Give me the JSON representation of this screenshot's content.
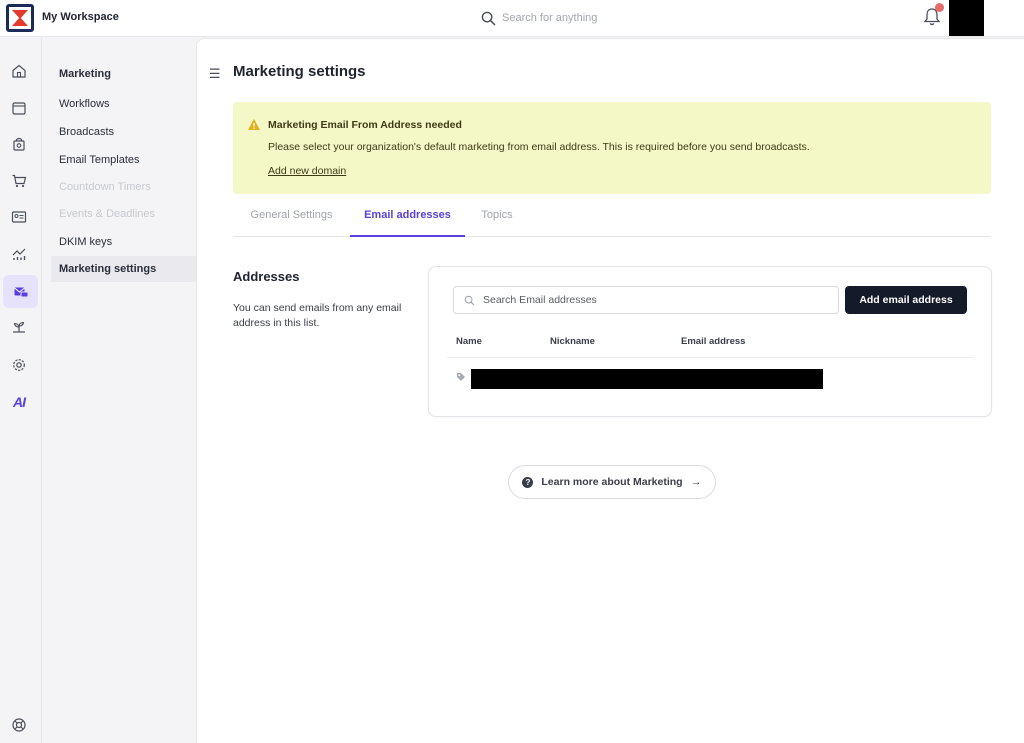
{
  "topbar": {
    "workspace_name": "My Workspace",
    "search_placeholder": "Search for anything"
  },
  "rail": {
    "icons": [
      "home-icon",
      "calendar-icon",
      "store-icon",
      "cart-icon",
      "contact-card-icon",
      "analytics-icon",
      "marketing-icon",
      "sprout-icon",
      "settings-icon",
      "ai-icon",
      "help-icon"
    ],
    "ai_label": "AI",
    "active": "marketing-icon"
  },
  "subnav": {
    "title": "Marketing",
    "items": [
      {
        "label": "Workflows",
        "state": "normal"
      },
      {
        "label": "Broadcasts",
        "state": "normal"
      },
      {
        "label": "Email Templates",
        "state": "normal"
      },
      {
        "label": "Countdown Timers",
        "state": "disabled"
      },
      {
        "label": "Events & Deadlines",
        "state": "disabled"
      },
      {
        "label": "DKIM keys",
        "state": "normal"
      },
      {
        "label": "Marketing settings",
        "state": "selected"
      }
    ]
  },
  "main": {
    "title": "Marketing settings",
    "alert": {
      "title": "Marketing Email From Address needed",
      "body": "Please select your organization's default marketing from email address. This is required before you send broadcasts.",
      "link": "Add new domain"
    },
    "tabs": [
      {
        "label": "General Settings",
        "active": false
      },
      {
        "label": "Email addresses",
        "active": true
      },
      {
        "label": "Topics",
        "active": false
      }
    ],
    "addresses": {
      "heading": "Addresses",
      "description": "You can send emails from any email address in this list.",
      "search_placeholder": "Search Email addresses",
      "add_button": "Add email address",
      "columns": [
        "Name",
        "Nickname",
        "Email address"
      ]
    },
    "learn_more": "Learn more about Marketing"
  },
  "colors": {
    "accent": "#5b3fe0",
    "alert_bg": "#f4f8c6",
    "button_dark": "#151a2b",
    "notification_dot": "#ea6b6b"
  }
}
